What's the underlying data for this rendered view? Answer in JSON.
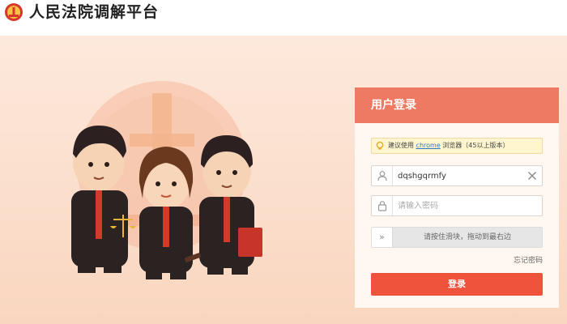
{
  "header": {
    "title": "人民法院调解平台",
    "emblem_icon": "court-emblem-icon"
  },
  "login": {
    "title": "用户登录",
    "notice": {
      "prefix": "建议使用",
      "link": "chrome",
      "suffix": "浏览器（45以上版本）",
      "icon": "lightbulb-icon"
    },
    "username": {
      "value": "dqshgqrmfy",
      "icon": "user-icon",
      "clear_icon": "close-icon"
    },
    "password": {
      "placeholder": "请输入密码",
      "icon": "lock-icon"
    },
    "slider": {
      "handle": "»",
      "text": "请按住滑块，拖动到最右边"
    },
    "forgot": "忘记密码",
    "submit": "登录"
  },
  "colors": {
    "accent": "#ef7a63",
    "button": "#f0533c",
    "background": "#fbe3d2"
  }
}
